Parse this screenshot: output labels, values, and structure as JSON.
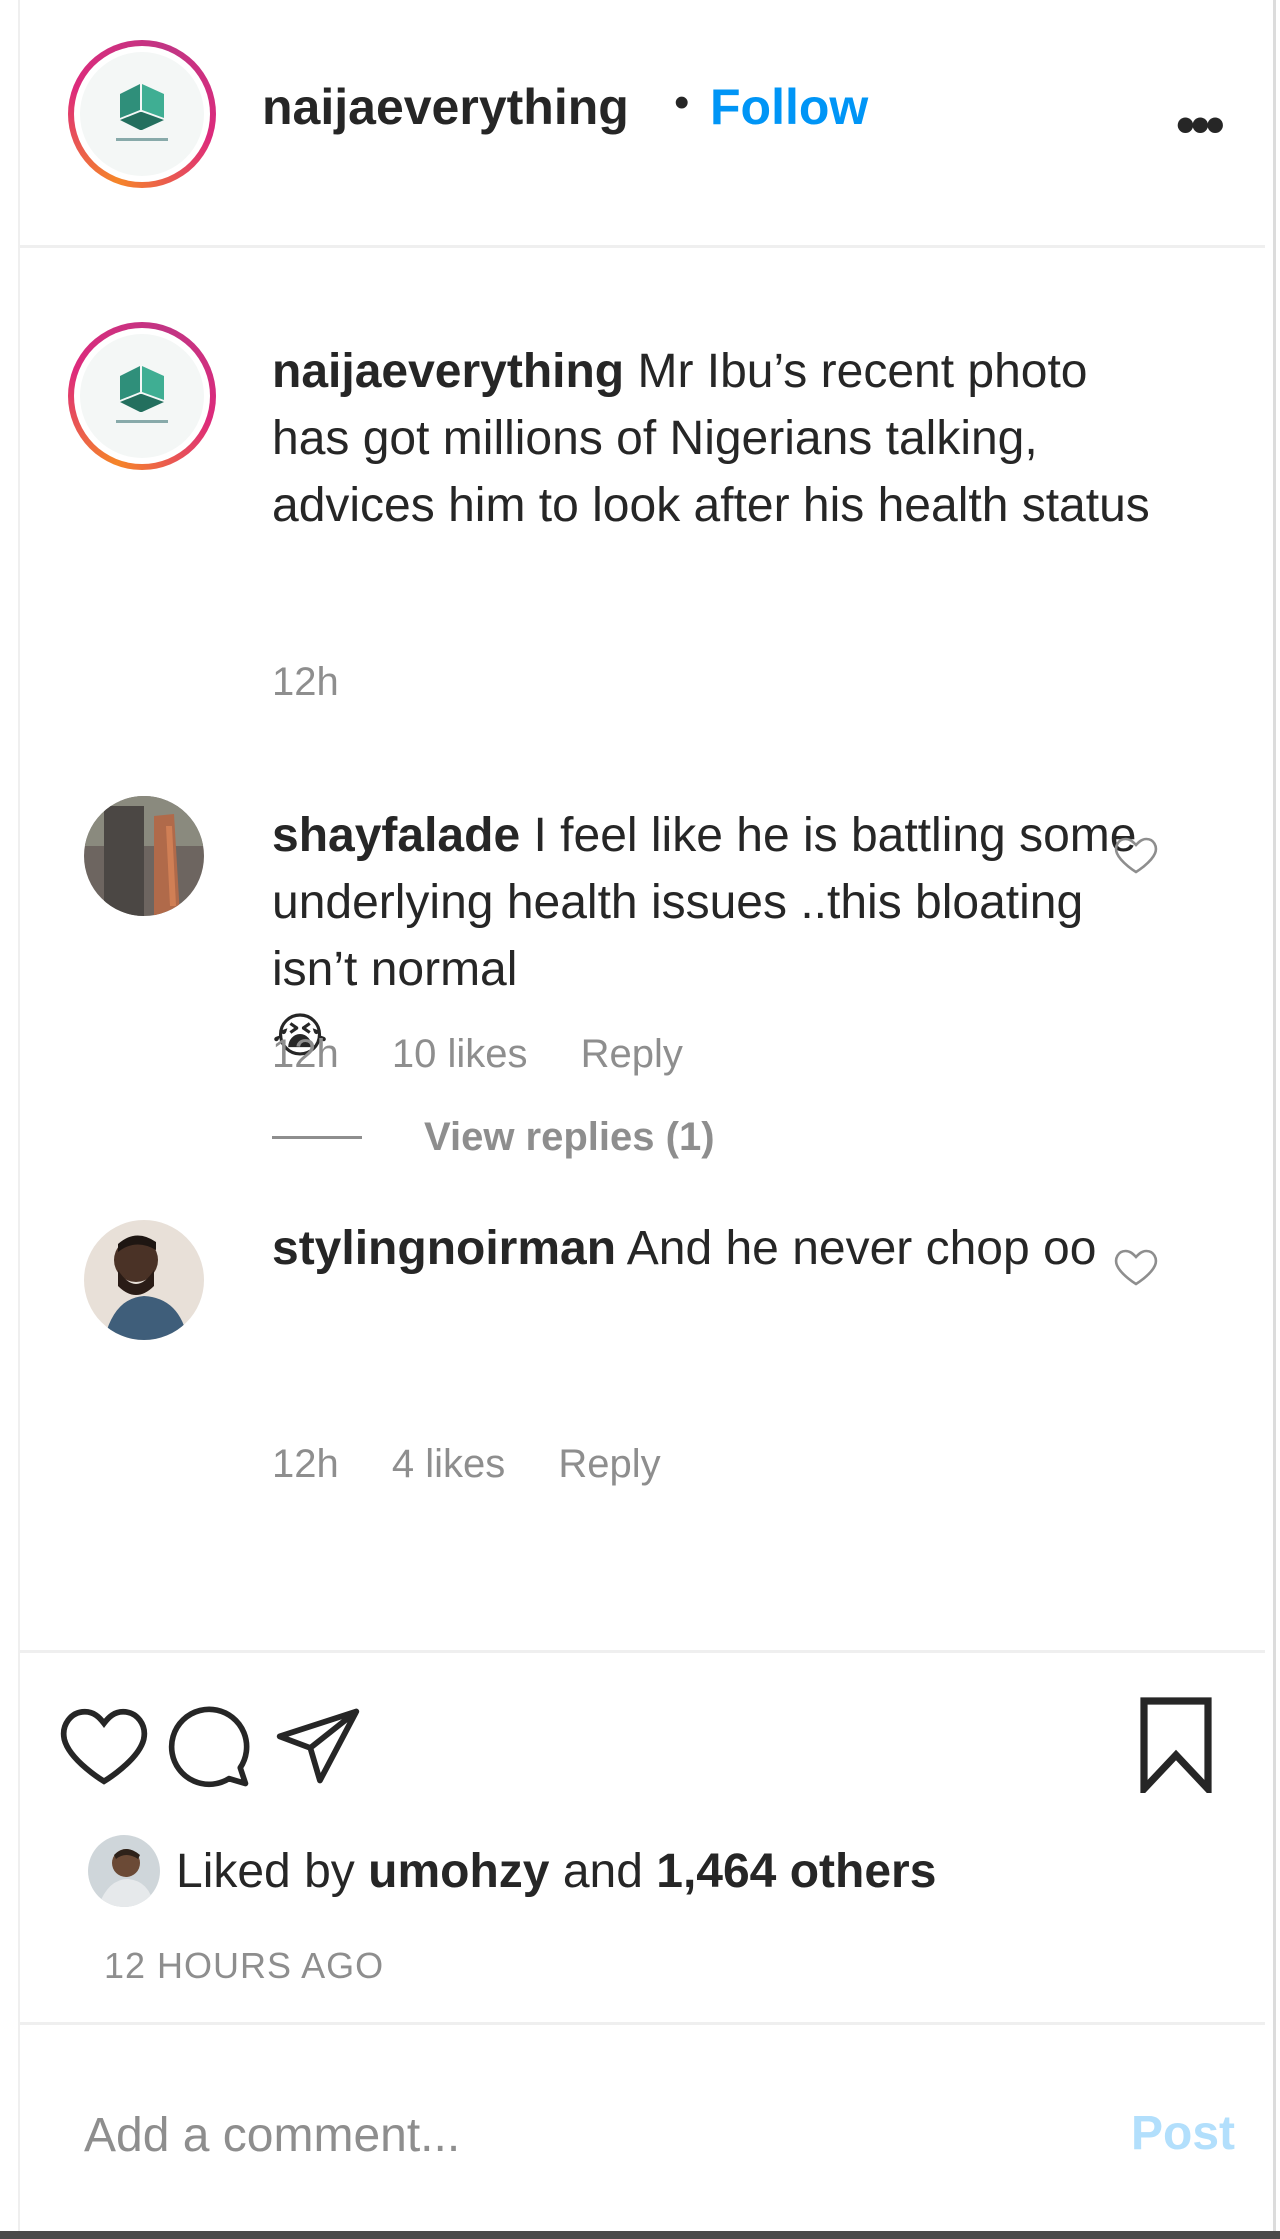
{
  "header": {
    "username": "naijaeverything",
    "separator": "•",
    "follow_label": "Follow",
    "more_label": "•••"
  },
  "caption": {
    "username": "naijaeverything",
    "text": "Mr Ibu’s recent photo has got millions of Nigerians talking, advices him to look after his health status",
    "time": "12h"
  },
  "comments": [
    {
      "username": "shayfalade",
      "text": "I feel like he is battling some underlying health issues ..this bloating isn’t normal",
      "emoji": "😭",
      "time": "12h",
      "likes": "10 likes",
      "reply_label": "Reply"
    },
    {
      "username": "stylingnoirman",
      "text": "And he never chop oo",
      "time": "12h",
      "likes": "4 likes",
      "reply_label": "Reply"
    }
  ],
  "view_replies_label": "View replies (1)",
  "actions": {
    "like_icon": "heart-icon",
    "comment_icon": "comment-icon",
    "share_icon": "paper-plane-icon",
    "save_icon": "bookmark-icon"
  },
  "likes_summary": {
    "prefix": "Liked by",
    "user": "umohzy",
    "and": "and",
    "others": "1,464 others"
  },
  "timestamp": "12 HOURS AGO",
  "add_comment": {
    "placeholder": "Add a comment...",
    "post_label": "Post"
  },
  "colors": {
    "accent": "#0095f6",
    "post_disabled": "#b2dffc",
    "muted": "#8e8e8e",
    "text": "#262626"
  }
}
